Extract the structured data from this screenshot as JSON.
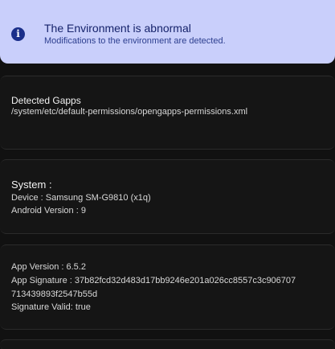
{
  "alert": {
    "icon": "info-icon",
    "icon_glyph": "i",
    "title": "The Environment is abnormal",
    "subtitle": "Modifications to the environment are detected.",
    "colors": {
      "background": "#c9cffb",
      "title": "#16236b",
      "subtitle": "#2d3f8f",
      "icon": "#1b2f8a"
    }
  },
  "gapps": {
    "heading": "Detected Gapps",
    "path": "/system/etc/default-permissions/opengapps-permissions.xml"
  },
  "system": {
    "heading": "System :",
    "device": "Device : Samsung SM-G9810  (x1q)",
    "android_version": "Android Version : 9"
  },
  "app": {
    "version": "App Version : 6.5.2",
    "signature_line_1": "App Signature : 37b82fcd32d483d17bb9246e201a026cc8557c3c906707",
    "signature_line_2": "713439893f2547b55d",
    "signature_valid": "Signature Valid: true"
  },
  "theme": {
    "background": "#111111",
    "card_background": "#151515",
    "card_border": "#2b2b2b",
    "text": "#d8d8d8"
  }
}
